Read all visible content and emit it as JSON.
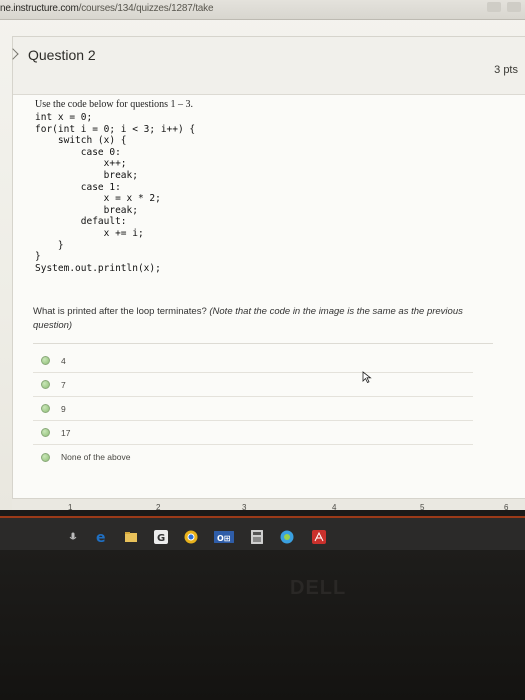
{
  "browser": {
    "url_domain": "ne.instructure.com",
    "url_path": "/courses/134/quizzes/1287/take"
  },
  "question": {
    "title": "Question 2",
    "points": "3 pts",
    "intro": "Use the code below for questions 1 – 3.",
    "code_lines": [
      "int x = 0;",
      "for(int i = 0; i < 3; i++) {",
      "    switch (x) {",
      "        case 0:",
      "            x++;",
      "            break;",
      "        case 1:",
      "            x = x * 2;",
      "            break;",
      "        default:",
      "            x += i;",
      "    }",
      "}",
      "System.out.println(x);"
    ],
    "prompt_text": "What is printed after the loop terminates?",
    "prompt_note": "(Note that the code in the image is the same as the previous question)",
    "options": [
      {
        "label": "4"
      },
      {
        "label": "7"
      },
      {
        "label": "9"
      },
      {
        "label": "17"
      },
      {
        "label": "None of the above"
      }
    ]
  },
  "page_numbers": [
    "1",
    "2",
    "3",
    "4",
    "5",
    "6"
  ],
  "colors": {
    "radio_fill": "#9ccb84",
    "taskbar": "#2b2a29",
    "ie_blue": "#1f6fc2",
    "chrome_yellow": "#e8b21c"
  },
  "taskbar_icons": [
    "microphone-icon",
    "internet-explorer-icon",
    "file-explorer-icon",
    "google-docs-icon",
    "chrome-icon",
    "office-icon",
    "calculator-icon",
    "chrome-app-icon",
    "acrobat-icon"
  ],
  "brand": "DELL"
}
